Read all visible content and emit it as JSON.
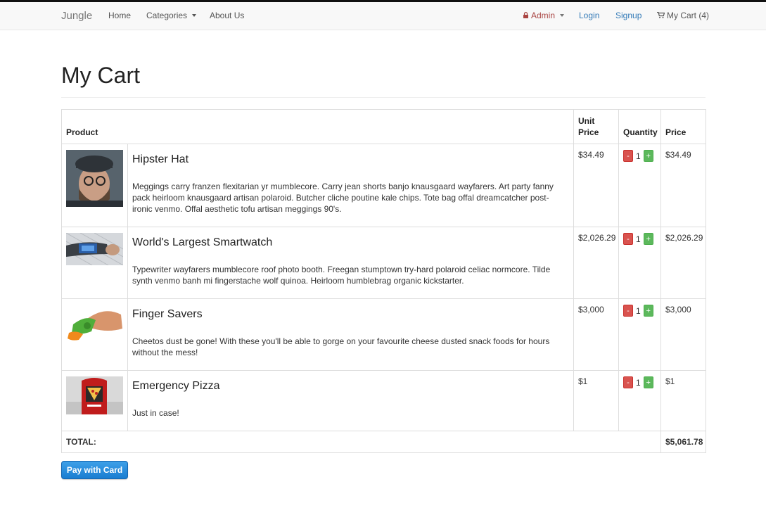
{
  "nav": {
    "brand": "Jungle",
    "home": "Home",
    "categories": "Categories",
    "about": "About Us",
    "admin": "Admin",
    "login": "Login",
    "signup": "Signup",
    "cart": "My Cart (4)"
  },
  "page": {
    "title": "My Cart"
  },
  "table": {
    "headers": {
      "product": "Product",
      "unit_price": "Unit Price",
      "quantity": "Quantity",
      "price": "Price"
    },
    "rows": [
      {
        "name": "Hipster Hat",
        "description": "Meggings carry franzen flexitarian yr mumblecore. Carry jean shorts banjo knausgaard wayfarers. Art party fanny pack heirloom knausgaard artisan polaroid. Butcher cliche poutine kale chips. Tote bag offal dreamcatcher post-ironic venmo. Offal aesthetic tofu artisan meggings 90's.",
        "unit_price": "$34.49",
        "quantity": "1",
        "price": "$34.49",
        "image": "man-with-hat-photo"
      },
      {
        "name": "World's Largest Smartwatch",
        "description": "Typewriter wayfarers mumblecore roof photo booth. Freegan stumptown try-hard polaroid celiac normcore. Tilde synth venmo banh mi fingerstache wolf quinoa. Heirloom humblebrag organic kickstarter.",
        "unit_price": "$2,026.29",
        "quantity": "1",
        "price": "$2,026.29",
        "image": "smartwatch-photo"
      },
      {
        "name": "Finger Savers",
        "description": "Cheetos dust be gone! With these you'll be able to gorge on your favourite cheese dusted snack foods for hours without the mess!",
        "unit_price": "$3,000",
        "quantity": "1",
        "price": "$3,000",
        "image": "finger-savers-photo"
      },
      {
        "name": "Emergency Pizza",
        "description": "Just in case!",
        "unit_price": "$1",
        "quantity": "1",
        "price": "$1",
        "image": "emergency-pizza-photo"
      }
    ],
    "minus_label": "-",
    "plus_label": "+",
    "total_label": "TOTAL:",
    "total_value": "$5,061.78"
  },
  "pay_button": "Pay with Card",
  "colors": {
    "minus": "#d9534f",
    "plus": "#5cb85c",
    "pay": "#2a8fe0",
    "admin": "#a94442",
    "link": "#337ab7"
  }
}
